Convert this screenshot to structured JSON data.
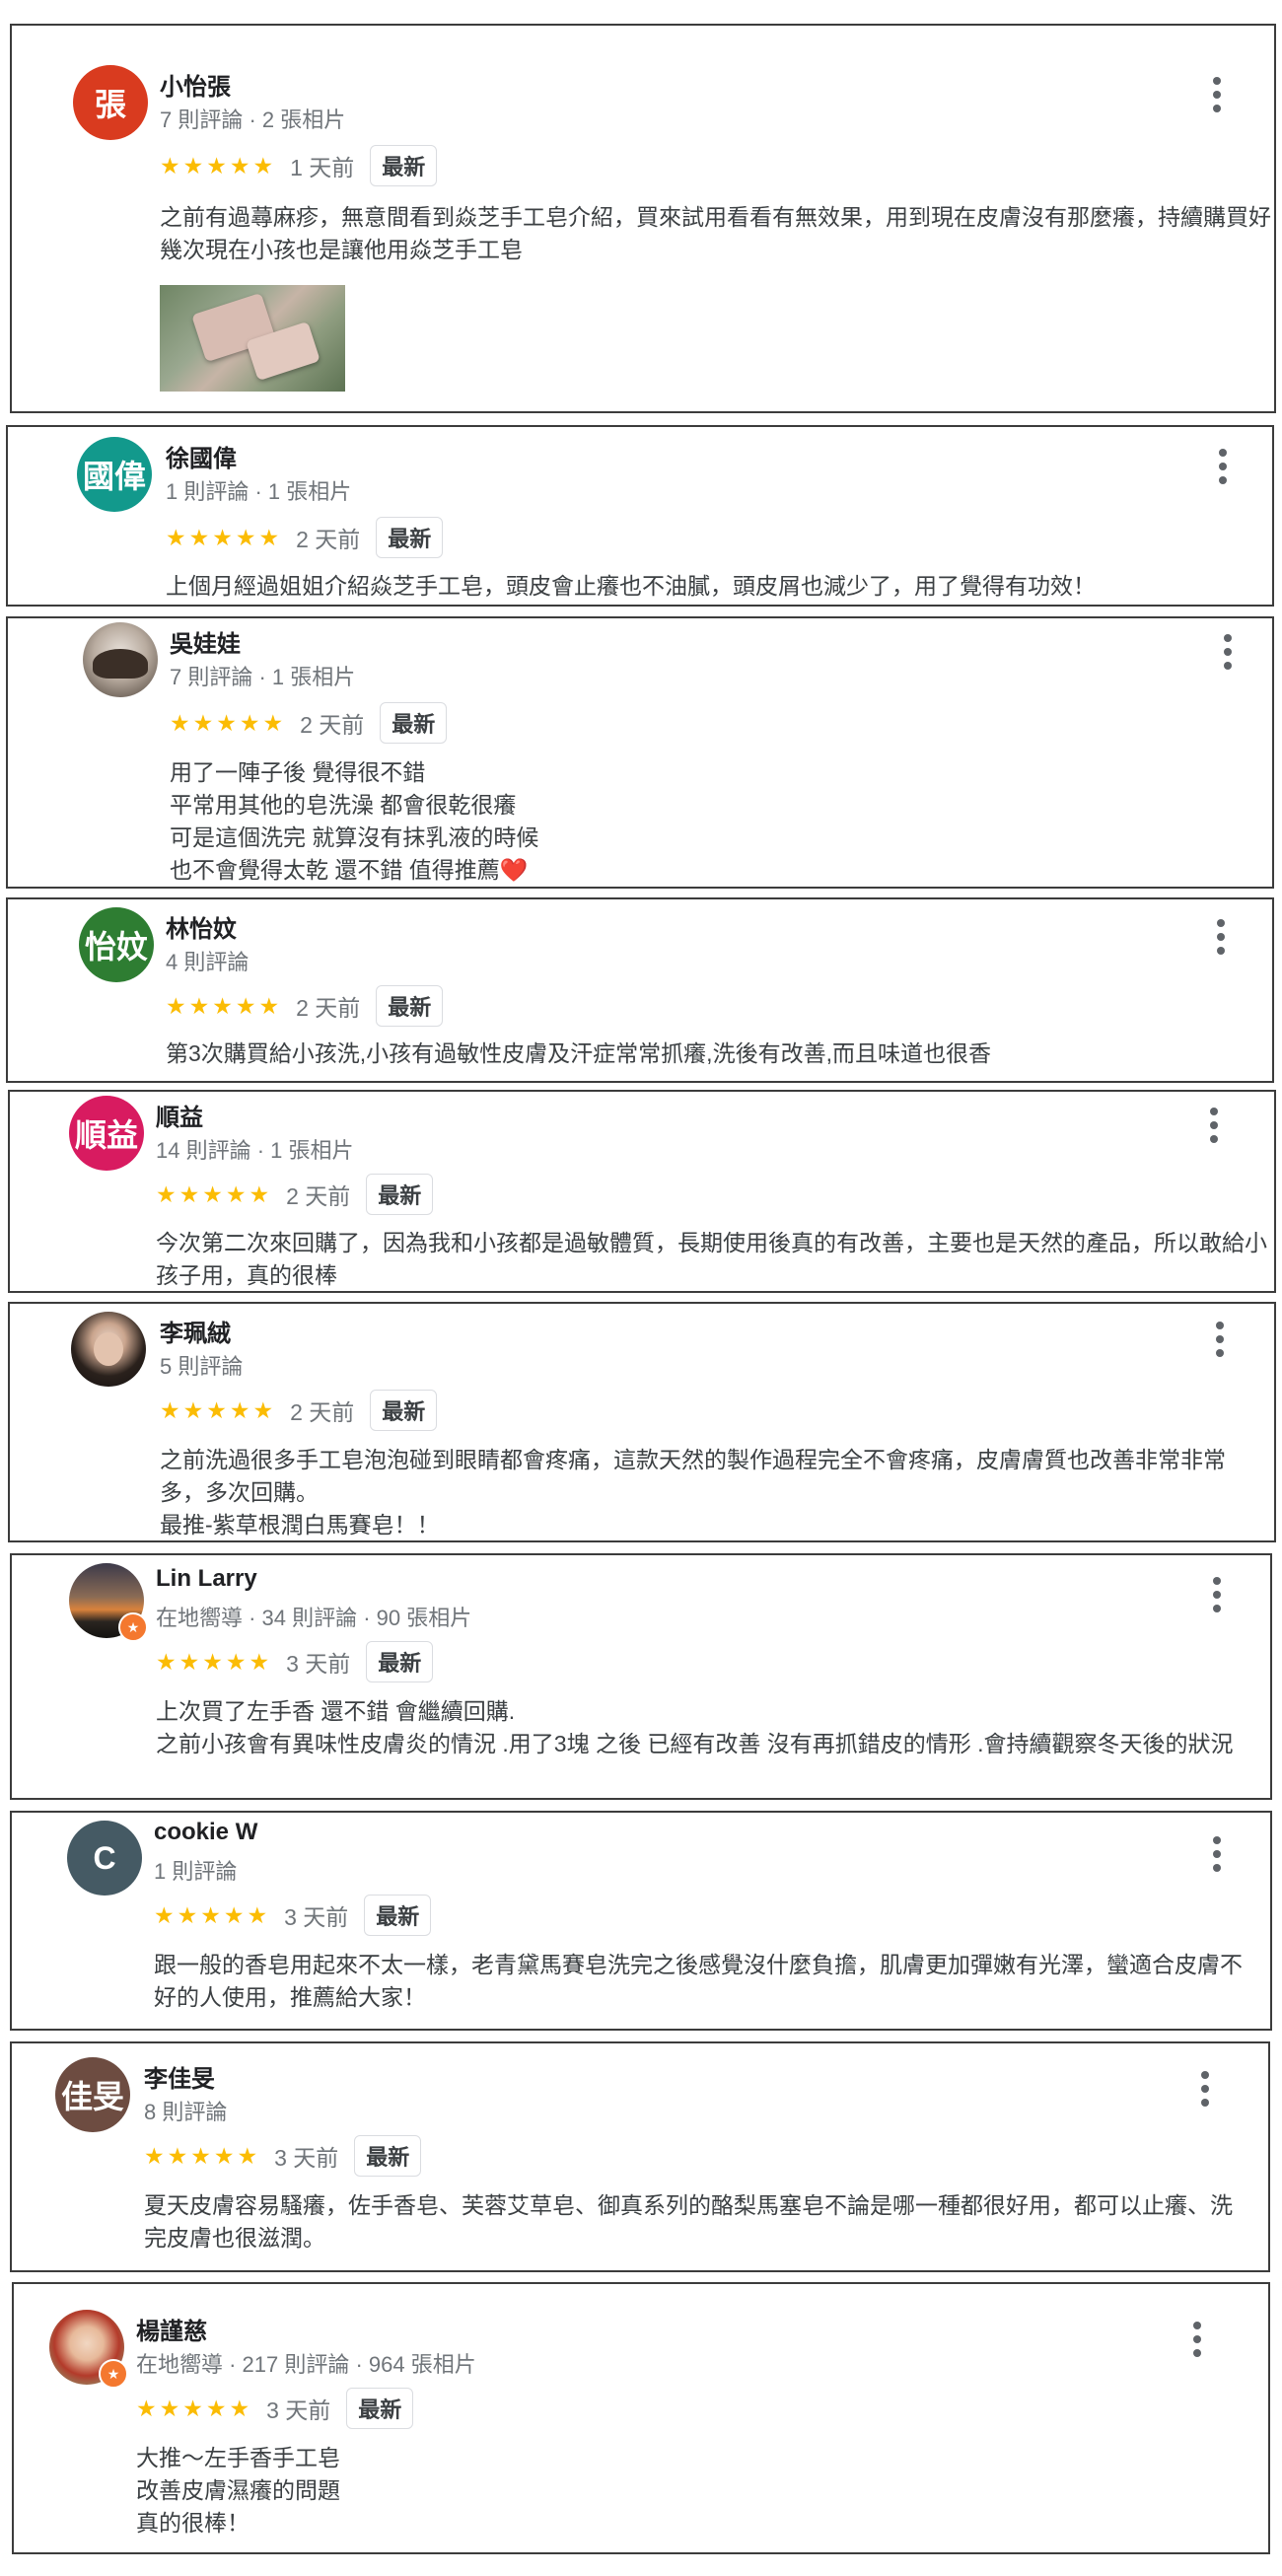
{
  "reviews": [
    {
      "name": "小怡張",
      "avatar_text": "張",
      "avatar_color": "#d93b1f",
      "meta": "7 則評論 · 2 張相片",
      "stars": "★★★★★",
      "time": "1 天前",
      "badge": "最新",
      "text": "之前有過蕁麻疹，無意間看到焱芝手工皂介紹，買來試用看看有無效果，用到現在皮膚沒有那麼癢，持續購買好幾次現在小孩也是讓他用焱芝手工皂",
      "photo_icon": "soap-photo-thumbnail"
    },
    {
      "name": "徐國偉",
      "avatar_text": "國偉",
      "avatar_color": "#12998c",
      "meta": "1 則評論 · 1 張相片",
      "stars": "★★★★★",
      "time": "2 天前",
      "badge": "最新",
      "text": "上個月經過姐姐介紹焱芝手工皂，頭皮會止癢也不油膩，頭皮屑也減少了，用了覺得有功效！"
    },
    {
      "name": "吳娃娃",
      "avatar_icon": "profile-photo",
      "meta": "7 則評論 · 1 張相片",
      "stars": "★★★★★",
      "time": "2 天前",
      "badge": "最新",
      "text": "用了一陣子後 覺得很不錯\n平常用其他的皂洗澡 都會很乾很癢\n可是這個洗完 就算沒有抹乳液的時候\n也不會覺得太乾 還不錯 值得推薦❤️"
    },
    {
      "name": "林怡妏",
      "avatar_text": "怡妏",
      "avatar_color": "#2e7d32",
      "meta": "4 則評論",
      "stars": "★★★★★",
      "time": "2 天前",
      "badge": "最新",
      "text": "第3次購買給小孩洗,小孩有過敏性皮膚及汗症常常抓癢,洗後有改善,而且味道也很香"
    },
    {
      "name": "順益",
      "avatar_text": "順益",
      "avatar_color": "#d81b60",
      "meta": "14 則評論 · 1 張相片",
      "stars": "★★★★★",
      "time": "2 天前",
      "badge": "最新",
      "text": "今次第二次來回購了，因為我和小孩都是過敏體質，長期使用後真的有改善，主要也是天然的產品，所以敢給小孩子用，真的很棒"
    },
    {
      "name": "李珮絨",
      "avatar_icon": "profile-photo",
      "meta": "5 則評論",
      "stars": "★★★★★",
      "time": "2 天前",
      "badge": "最新",
      "text": "之前洗過很多手工皂泡泡碰到眼睛都會疼痛，這款天然的製作過程完全不會疼痛，皮膚膚質也改善非常非常多，多次回購。\n最推-紫草根潤白馬賽皂！！"
    },
    {
      "name": "Lin Larry",
      "avatar_icon": "profile-photo",
      "guide_icon": "local-guide-star-icon",
      "meta": "在地嚮導 · 34 則評論 · 90 張相片",
      "stars": "★★★★★",
      "time": "3 天前",
      "badge": "最新",
      "text": "上次買了左手香 還不錯 會繼續回購.\n之前小孩會有異味性皮膚炎的情況 .用了3塊 之後 已經有改善 沒有再抓錯皮的情形 .會持續觀察冬天後的狀況"
    },
    {
      "name": "cookie W",
      "avatar_text": "C",
      "avatar_color": "#455a64",
      "meta": "1 則評論",
      "stars": "★★★★★",
      "time": "3 天前",
      "badge": "最新",
      "text": "跟一般的香皂用起來不太一樣，老青黛馬賽皂洗完之後感覺沒什麼負擔，肌膚更加彈嫩有光澤，蠻適合皮膚不好的人使用，推薦給大家！"
    },
    {
      "name": "李佳旻",
      "avatar_text": "佳旻",
      "avatar_color": "#6d4c41",
      "meta": "8 則評論",
      "stars": "★★★★★",
      "time": "3 天前",
      "badge": "最新",
      "text": "夏天皮膚容易騷癢，佐手香皂、芙蓉艾草皂、御真系列的酪梨馬塞皂不論是哪一種都很好用，都可以止癢、洗完皮膚也很滋潤。"
    },
    {
      "name": "楊謹慈",
      "avatar_icon": "profile-photo",
      "guide_icon": "local-guide-star-icon",
      "meta": "在地嚮導 · 217 則評論 · 964 張相片",
      "stars": "★★★★★",
      "time": "3 天前",
      "badge": "最新",
      "text": "大推～左手香手工皂\n改善皮膚濕癢的問題\n真的很棒！"
    }
  ]
}
